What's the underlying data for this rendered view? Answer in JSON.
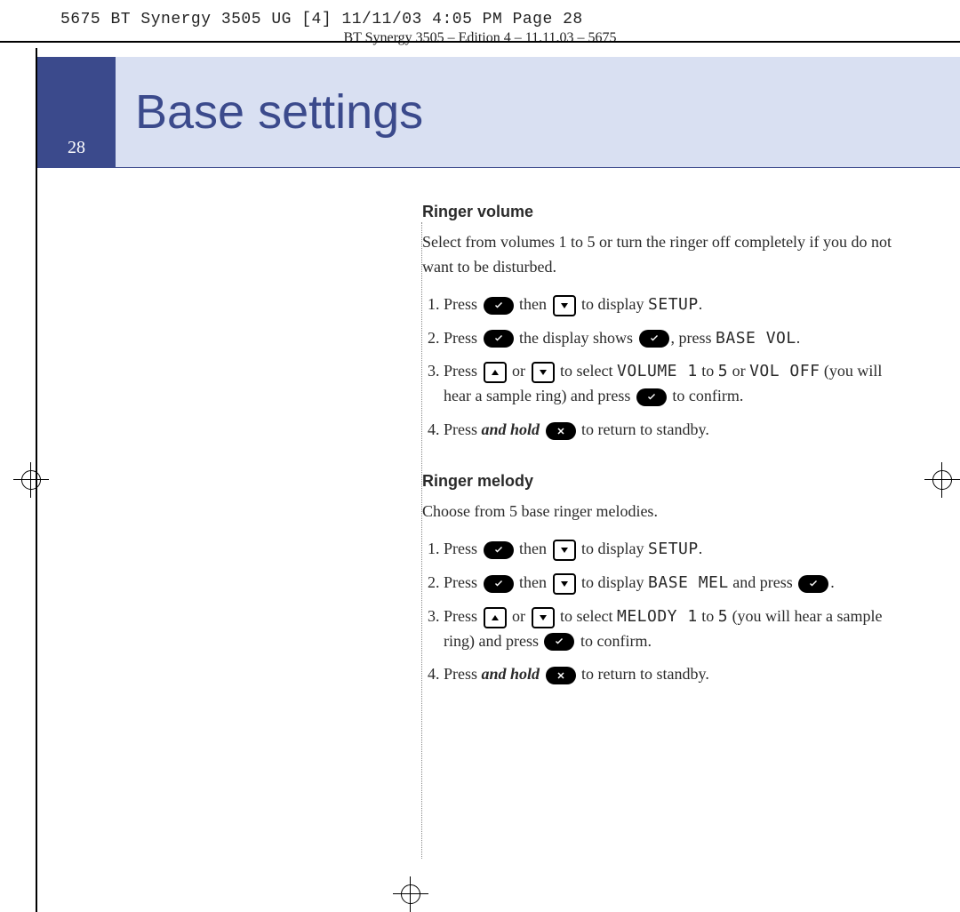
{
  "print_header": "5675 BT Synergy 3505 UG [4]  11/11/03  4:05 PM  Page 28",
  "edition_line": "BT Synergy 3505 – Edition 4 – 11.11.03 – 5675",
  "page_number": "28",
  "page_title": "Base settings",
  "sections": [
    {
      "heading": "Ringer volume",
      "intro": "Select from volumes 1 to 5 or turn the ringer off completely if you do not want to be disturbed.",
      "steps": [
        {
          "before": "Press ",
          "icon1": "check",
          "mid1": " then ",
          "icon2": "down-sq",
          "mid2": " to display ",
          "lcd1": "SETUP",
          "after": "."
        },
        {
          "before": "Press ",
          "icon1": "check",
          "mid1": " the display shows ",
          "lcd1": "BASE VOL",
          "mid2": ", press ",
          "icon2": "check",
          "after": "."
        },
        {
          "before": "Press ",
          "icon1": "up-sq",
          "mid1": " or ",
          "icon2": "down-sq",
          "mid2": " to select ",
          "lcd1": "VOLUME 1",
          "mid3": " to ",
          "lcd2": "5",
          "mid4": " or ",
          "lcd3": "VOL OFF",
          "mid5": " (you will hear a sample ring) and press ",
          "icon3": "check",
          "after": " to confirm."
        },
        {
          "before": "Press ",
          "em": "and hold",
          "mid1": " ",
          "icon1": "cross",
          "after": " to return to standby."
        }
      ]
    },
    {
      "heading": "Ringer melody",
      "intro": "Choose from 5 base ringer melodies.",
      "steps": [
        {
          "before": "Press ",
          "icon1": "check",
          "mid1": " then ",
          "icon2": "down-sq",
          "mid2": " to display ",
          "lcd1": "SETUP",
          "after": "."
        },
        {
          "before": "Press ",
          "icon1": "check",
          "mid1": " then ",
          "icon2": "down-sq",
          "mid2": " to display ",
          "lcd1": "BASE MEL",
          "mid3": " and press ",
          "icon3": "check",
          "after": "."
        },
        {
          "before": "Press ",
          "icon1": "up-sq",
          "mid1": " or ",
          "icon2": "down-sq",
          "mid2": " to select ",
          "lcd1": "MELODY 1",
          "mid3": " to ",
          "lcd2": "5",
          "mid4": " (you will hear a sample ring) and press ",
          "icon3": "check",
          "after": " to confirm."
        },
        {
          "before": "Press ",
          "em": "and hold",
          "mid1": " ",
          "icon1": "cross",
          "after": " to return to standby."
        }
      ]
    }
  ]
}
